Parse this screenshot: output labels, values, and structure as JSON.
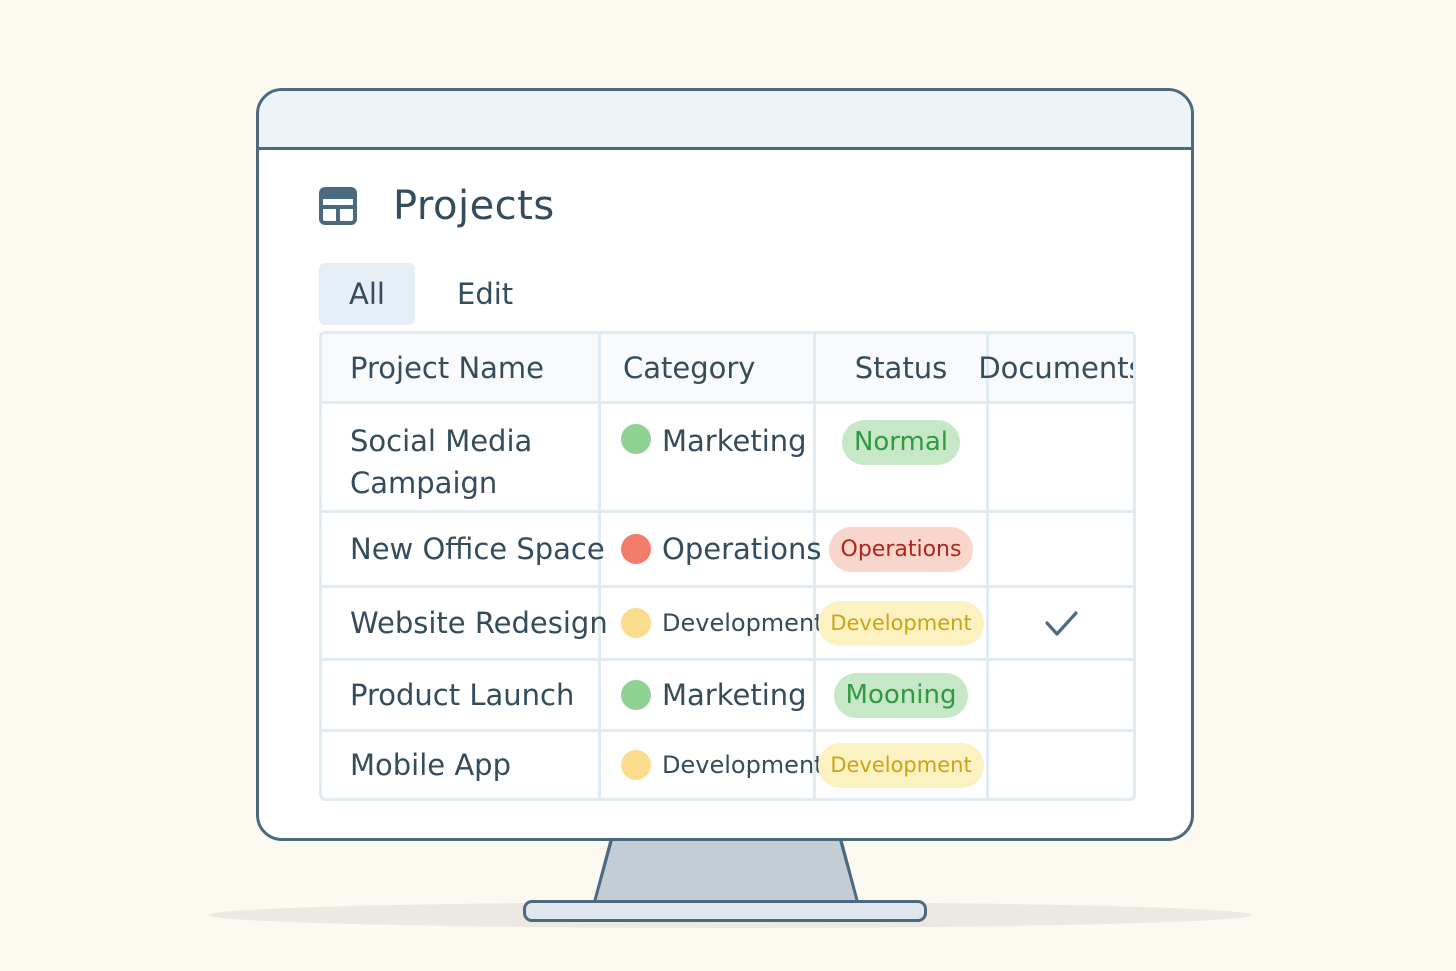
{
  "page": {
    "title": "Projects",
    "icon": "table-layout-icon"
  },
  "tabs": [
    {
      "label": "All",
      "active": true
    },
    {
      "label": "Edit",
      "active": false
    }
  ],
  "table": {
    "columns": [
      "Project Name",
      "Category",
      "Status",
      "Documents"
    ],
    "rows": [
      {
        "name": "Social Media Campaign",
        "category": "Marketing",
        "category_color": "#8fd294",
        "status": "Normal",
        "status_tone": "green",
        "documents": ""
      },
      {
        "name": "New Office Space",
        "category": "Operations",
        "category_color": "#f37b6b",
        "status": "Operations",
        "status_tone": "red",
        "documents": ""
      },
      {
        "name": "Website Redesign",
        "category": "Development",
        "category_color": "#fbdc8c",
        "status": "Development",
        "status_tone": "yellow",
        "documents": "check-icon"
      },
      {
        "name": "Product Launch",
        "category": "Marketing",
        "category_color": "#8fd294",
        "status": "Mooning",
        "status_tone": "green",
        "documents": ""
      },
      {
        "name": "Mobile App",
        "category": "Development",
        "category_color": "#fbdc8c",
        "status": "Development",
        "status_tone": "yellow",
        "documents": ""
      }
    ]
  },
  "colors": {
    "background": "#fcf9f1",
    "frame": "#4c6a7f",
    "title_bar": "#edf2f7",
    "text": "#344c5c",
    "grid_line": "#e1ebf2",
    "green_pill": "#c7e8c6",
    "green_text": "#2f9a43",
    "red_pill": "#f8d6cc",
    "red_text": "#b0241c",
    "yellow_pill": "#fcf1c1",
    "yellow_text": "#c9a514"
  }
}
